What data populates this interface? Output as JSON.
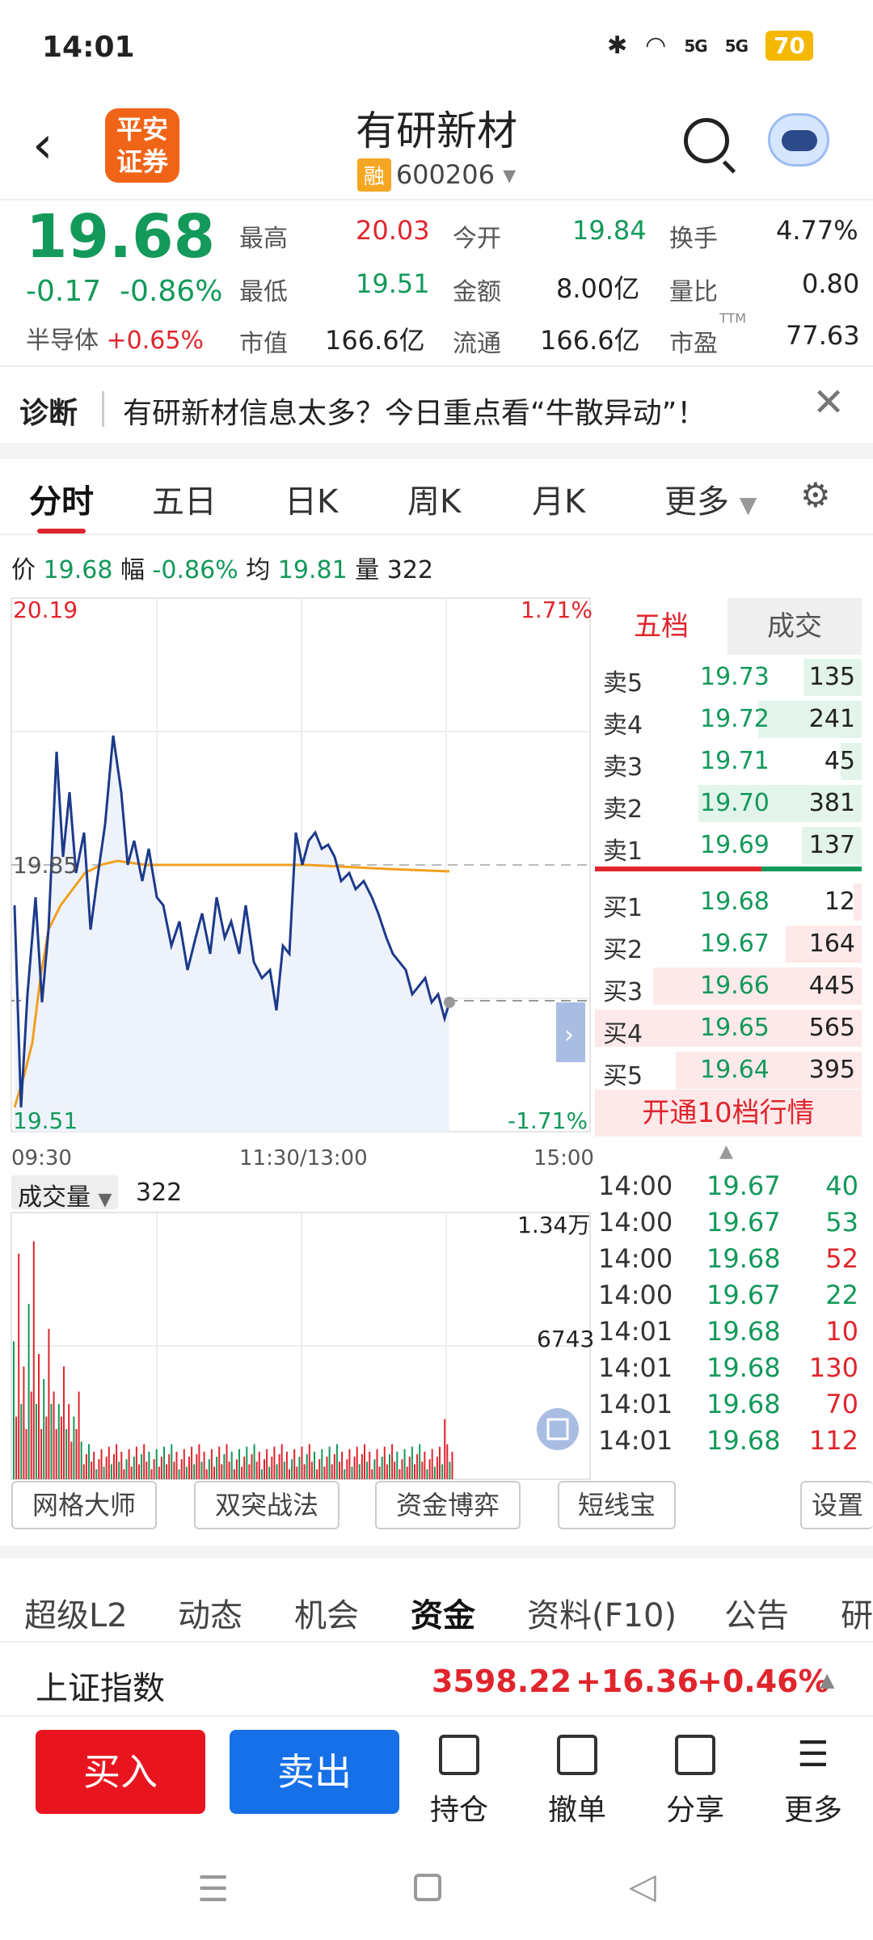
{
  "status": {
    "time": "14:01",
    "battery": "70",
    "net1": "5G",
    "net2": "5G"
  },
  "header": {
    "title": "有研新材",
    "badge": "融",
    "code": "600206",
    "logo_line1": "平安",
    "logo_line2": "证券"
  },
  "quote": {
    "price": "19.68",
    "change": "-0.17",
    "change_pct": "-0.86%",
    "industry": "半导体",
    "industry_pct": "+0.65%",
    "high_lbl": "最高",
    "high": "20.03",
    "open_lbl": "今开",
    "open": "19.84",
    "turn_lbl": "换手",
    "turn": "4.77%",
    "low_lbl": "最低",
    "low": "19.51",
    "amt_lbl": "金额",
    "amt": "8.00亿",
    "vr_lbl": "量比",
    "vr": "0.80",
    "mcap_lbl": "市值",
    "mcap": "166.6亿",
    "float_lbl": "流通",
    "float": "166.6亿",
    "pe_lbl": "市盈",
    "pe_sup": "TTM",
    "pe": "77.63"
  },
  "diagnosis": {
    "tag": "诊断",
    "message": "有研新材信息太多？今日重点看“牛散异动”！"
  },
  "tabs": [
    "分时",
    "五日",
    "日K",
    "周K",
    "月K",
    "更多"
  ],
  "info": {
    "price_lbl": "价",
    "price": "19.68",
    "amp_lbl": "幅",
    "amp": "-0.86%",
    "avg_lbl": "均",
    "avg": "19.81",
    "vol_lbl": "量",
    "vol": "322"
  },
  "chart": {
    "y_top": "20.19",
    "y_mid": "19.85",
    "y_bot": "19.51",
    "pct_top": "1.71%",
    "pct_bot": "-1.71%",
    "x_start": "09:30",
    "x_mid": "11:30/13:00",
    "x_end": "15:00",
    "vol_select": "成交量",
    "vol_val": "322",
    "vol_top": "1.34万",
    "vol_mid": "6743"
  },
  "orderbook": {
    "tab_active": "五档",
    "tab_other": "成交",
    "sells": [
      {
        "label": "卖5",
        "price": "19.73",
        "vol": "135"
      },
      {
        "label": "卖4",
        "price": "19.72",
        "vol": "241"
      },
      {
        "label": "卖3",
        "price": "19.71",
        "vol": "45"
      },
      {
        "label": "卖2",
        "price": "19.70",
        "vol": "381"
      },
      {
        "label": "卖1",
        "price": "19.69",
        "vol": "137"
      }
    ],
    "buys": [
      {
        "label": "买1",
        "price": "19.68",
        "vol": "12"
      },
      {
        "label": "买2",
        "price": "19.67",
        "vol": "164"
      },
      {
        "label": "买3",
        "price": "19.66",
        "vol": "445"
      },
      {
        "label": "买4",
        "price": "19.65",
        "vol": "565"
      },
      {
        "label": "买5",
        "price": "19.64",
        "vol": "395"
      }
    ],
    "upgrade": "开通10档行情"
  },
  "trades": [
    {
      "time": "14:00",
      "price": "19.67",
      "vol": "40",
      "side": "green"
    },
    {
      "time": "14:00",
      "price": "19.67",
      "vol": "53",
      "side": "green"
    },
    {
      "time": "14:00",
      "price": "19.68",
      "vol": "52",
      "side": "red"
    },
    {
      "time": "14:00",
      "price": "19.67",
      "vol": "22",
      "side": "green"
    },
    {
      "time": "14:01",
      "price": "19.68",
      "vol": "10",
      "side": "red"
    },
    {
      "time": "14:01",
      "price": "19.68",
      "vol": "130",
      "side": "red"
    },
    {
      "time": "14:01",
      "price": "19.68",
      "vol": "70",
      "side": "red"
    },
    {
      "time": "14:01",
      "price": "19.68",
      "vol": "112",
      "side": "red"
    }
  ],
  "tools": [
    "网格大师",
    "双突战法",
    "资金博弈",
    "短线宝",
    "设置"
  ],
  "subtabs": [
    "超级L2",
    "动态",
    "机会",
    "资金",
    "资料(F10)",
    "公告",
    "研"
  ],
  "index": {
    "name": "上证指数",
    "value": "3598.22",
    "change": "+16.36",
    "pct": "+0.46%"
  },
  "bottom": {
    "buy": "买入",
    "sell": "卖出",
    "hold": "持仓",
    "cancel": "撤单",
    "share": "分享",
    "more": "更多"
  },
  "colors": {
    "up": "#e0252d",
    "down": "#13995a",
    "accent": "#1670e8",
    "buy": "#e8151f"
  }
}
